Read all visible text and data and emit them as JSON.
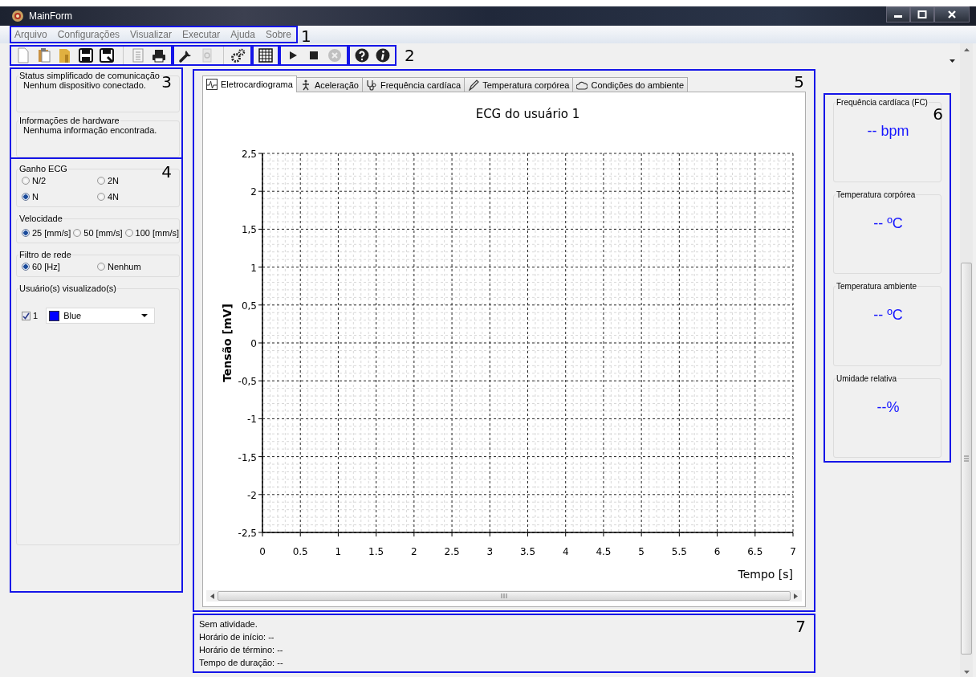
{
  "window": {
    "title": "MainForm"
  },
  "menu": {
    "marker": "1",
    "items": [
      "Arquivo",
      "Configurações",
      "Visualizar",
      "Executar",
      "Ajuda",
      "Sobre"
    ]
  },
  "toolbar": {
    "marker": "2",
    "groups": [
      [
        {
          "disabled": false,
          "separated": false
        },
        {
          "disabled": false,
          "separated": false
        },
        {
          "disabled": false,
          "separated": false
        },
        {
          "disabled": false,
          "separated": false
        },
        {
          "disabled": false,
          "separated": false
        },
        {
          "disabled": false,
          "separated": true
        },
        {
          "disabled": false,
          "separated": false
        }
      ],
      [
        {
          "disabled": false,
          "separated": false
        },
        {
          "disabled": true,
          "separated": false
        },
        {
          "disabled": false,
          "separated": true
        }
      ],
      [
        {
          "disabled": false,
          "separated": false
        }
      ],
      [
        {
          "disabled": false,
          "separated": false
        },
        {
          "disabled": false,
          "separated": false
        },
        {
          "disabled": true,
          "separated": false
        }
      ],
      [
        {
          "disabled": false,
          "separated": false
        },
        {
          "disabled": false,
          "separated": false
        }
      ]
    ]
  },
  "info_panel": {
    "marker": "3",
    "groups": [
      {
        "title": "Status simplificado de comunicação",
        "text": "Nenhum dispositivo conectado."
      },
      {
        "title": "Informações de hardware",
        "text": "Nenhuma informação encontrada."
      }
    ]
  },
  "settings_panel": {
    "marker": "4",
    "ecg_gain": {
      "title": "Ganho ECG",
      "options": [
        {
          "label": "N/2",
          "selected": false
        },
        {
          "label": "2N",
          "selected": false
        },
        {
          "label": "N",
          "selected": true
        },
        {
          "label": "4N",
          "selected": false
        }
      ]
    },
    "speed": {
      "title": "Velocidade",
      "options": [
        {
          "label": "25 [mm/s]",
          "selected": true
        },
        {
          "label": "50 [mm/s]",
          "selected": false
        },
        {
          "label": "100 [mm/s]",
          "selected": false
        }
      ]
    },
    "filter": {
      "title": "Filtro de rede",
      "options": [
        {
          "label": "60 [Hz]",
          "selected": true
        },
        {
          "label": "Nenhum",
          "selected": false
        }
      ]
    },
    "users": {
      "title": "Usuário(s) visualizado(s)",
      "rows": [
        {
          "checked": true,
          "label": "1",
          "color": "#0000ff",
          "value": "Blue"
        }
      ]
    }
  },
  "tabs_panel": {
    "marker": "5",
    "tabs": [
      {
        "label": "Eletrocardiograma",
        "selected": true
      },
      {
        "label": "Aceleração",
        "selected": false
      },
      {
        "label": "Frequência cardíaca",
        "selected": false
      },
      {
        "label": "Temperatura corpórea",
        "selected": false
      },
      {
        "label": "Condições do ambiente",
        "selected": false
      }
    ],
    "chart_data": {
      "type": "line",
      "grid": true,
      "title": "ECG do usuário 1",
      "xlabel": "Tempo [s]",
      "ylabel": "Tensão [mV]",
      "xlim": [
        0,
        7
      ],
      "ylim": [
        -2.5,
        2.5
      ],
      "xticks": [
        {
          "value": 0,
          "label": "0"
        },
        {
          "value": 0.5,
          "label": "0.5"
        },
        {
          "value": 1,
          "label": "1"
        },
        {
          "value": 1.5,
          "label": "1.5"
        },
        {
          "value": 2,
          "label": "2"
        },
        {
          "value": 2.5,
          "label": "2.5"
        },
        {
          "value": 3,
          "label": "3"
        },
        {
          "value": 3.5,
          "label": "3.5"
        },
        {
          "value": 4,
          "label": "4"
        },
        {
          "value": 4.5,
          "label": "4.5"
        },
        {
          "value": 5,
          "label": "5"
        },
        {
          "value": 5.5,
          "label": "5.5"
        },
        {
          "value": 6,
          "label": "6"
        },
        {
          "value": 6.5,
          "label": "6.5"
        },
        {
          "value": 7,
          "label": "7"
        }
      ],
      "yticks": [
        {
          "value": 2.5,
          "label": "2,5"
        },
        {
          "value": 2,
          "label": "2"
        },
        {
          "value": 1.5,
          "label": "1,5"
        },
        {
          "value": 1,
          "label": "1"
        },
        {
          "value": 0.5,
          "label": "0,5"
        },
        {
          "value": 0,
          "label": "0"
        },
        {
          "value": -0.5,
          "label": "-0,5"
        },
        {
          "value": -1,
          "label": "-1"
        },
        {
          "value": -1.5,
          "label": "-1,5"
        },
        {
          "value": -2,
          "label": "-2"
        },
        {
          "value": -2.5,
          "label": "-2,5"
        }
      ]
    }
  },
  "readings_panel": {
    "marker": "6",
    "items": [
      {
        "title": "Frequência cardíaca (FC)",
        "value": "-- bpm"
      },
      {
        "title": "Temperatura corpórea",
        "value": "-- ºC"
      },
      {
        "title": "Temperatura ambiente",
        "value": "-- ºC"
      },
      {
        "title": "Umidade relativa",
        "value": "--%"
      }
    ]
  },
  "status_panel": {
    "marker": "7",
    "lines": [
      "Sem atividade.",
      "Horário de início: --",
      "Horário de término: --",
      "Tempo de duração: --"
    ]
  }
}
